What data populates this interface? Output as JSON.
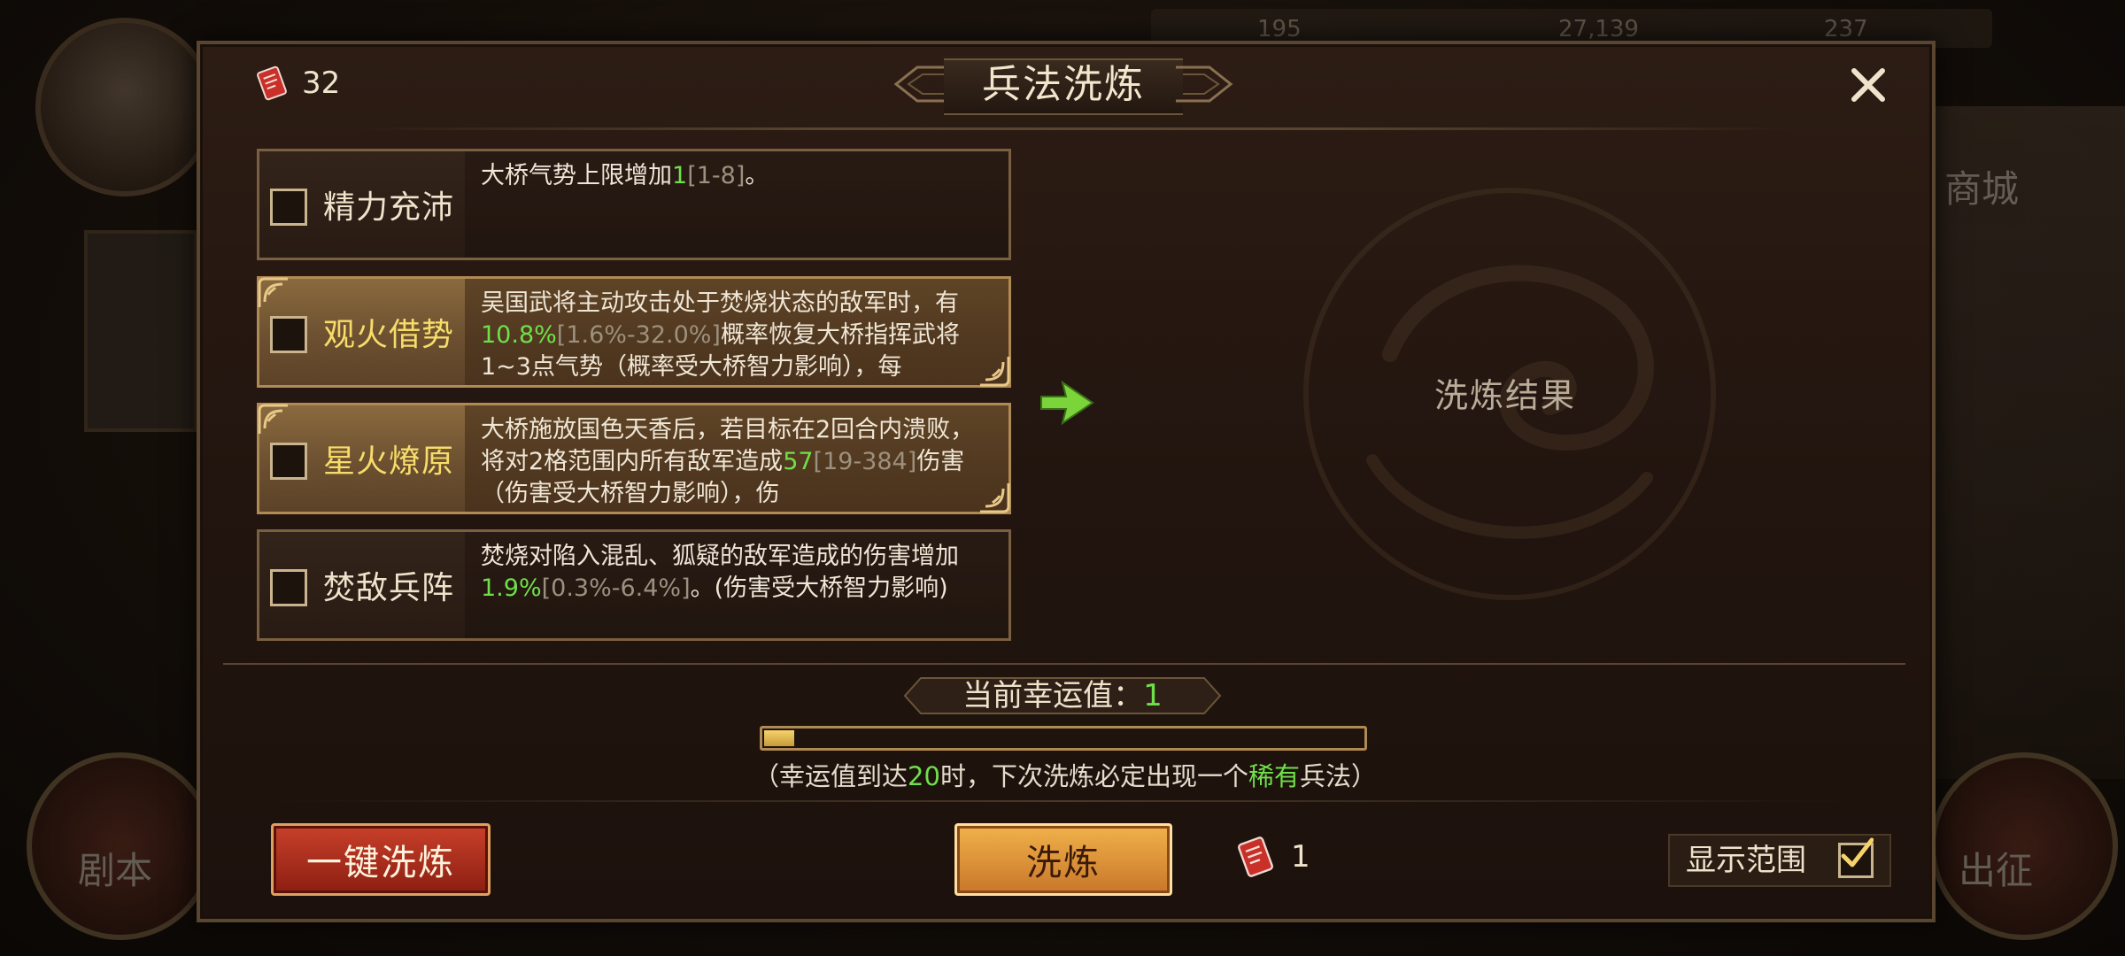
{
  "background": {
    "top_values": [
      "195",
      "27,139",
      "237"
    ],
    "right_top_label": "商城",
    "left_bottom_label": "剧本",
    "right_bottom_label": "出征"
  },
  "dialog": {
    "title": "兵法洗炼",
    "scroll_count": "32",
    "close_icon": "close-icon"
  },
  "skills": [
    {
      "name": "精力充沛",
      "rarity": "normal",
      "desc_parts": [
        {
          "t": "大桥气势上限增加",
          "c": "w"
        },
        {
          "t": "1",
          "c": "g"
        },
        {
          "t": "[1-8]",
          "c": "gray"
        },
        {
          "t": "。",
          "c": "w"
        }
      ]
    },
    {
      "name": "观火借势",
      "rarity": "rare",
      "desc_parts": [
        {
          "t": "吴国武将主动攻击处于焚烧状态的敌军时，有",
          "c": "w"
        },
        {
          "t": "10.8%",
          "c": "g"
        },
        {
          "t": "[1.6%-32.0%]",
          "c": "gray"
        },
        {
          "t": "概率恢复大桥指挥武将1~3点气势（概率受大桥智力影响），每",
          "c": "w"
        }
      ]
    },
    {
      "name": "星火燎原",
      "rarity": "rare",
      "desc_parts": [
        {
          "t": "大桥施放国色天香后，若目标在2回合内溃败，将对2格范围内所有敌军造成",
          "c": "w"
        },
        {
          "t": "57",
          "c": "g"
        },
        {
          "t": "[19-384]",
          "c": "gray"
        },
        {
          "t": "伤害（伤害受大桥智力影响），伤",
          "c": "w"
        }
      ]
    },
    {
      "name": "焚敌兵阵",
      "rarity": "normal",
      "desc_parts": [
        {
          "t": "焚烧对陷入混乱、狐疑的敌军造成的伤害增加",
          "c": "w"
        },
        {
          "t": "1.9%",
          "c": "g"
        },
        {
          "t": "[0.3%-6.4%]",
          "c": "gray"
        },
        {
          "t": "。(伤害受大桥智力影响)",
          "c": "w"
        }
      ]
    }
  ],
  "result": {
    "label": "洗炼结果"
  },
  "luck": {
    "label": "当前幸运值：",
    "value": "1",
    "max": 20,
    "hint_prefix": "（幸运值到达",
    "hint_threshold": "20",
    "hint_mid": "时，下次洗炼必定出现一个",
    "hint_rare": "稀有",
    "hint_suffix": "兵法）"
  },
  "actions": {
    "one_click_label": "一键洗炼",
    "refine_label": "洗炼",
    "cost": "1",
    "show_range_label": "显示范围",
    "show_range_checked": true
  },
  "colors": {
    "green": "#6fe04a",
    "gold_text": "#f6dc6a",
    "red_button": "#c8402a",
    "gold_button": "#f0b24a"
  }
}
